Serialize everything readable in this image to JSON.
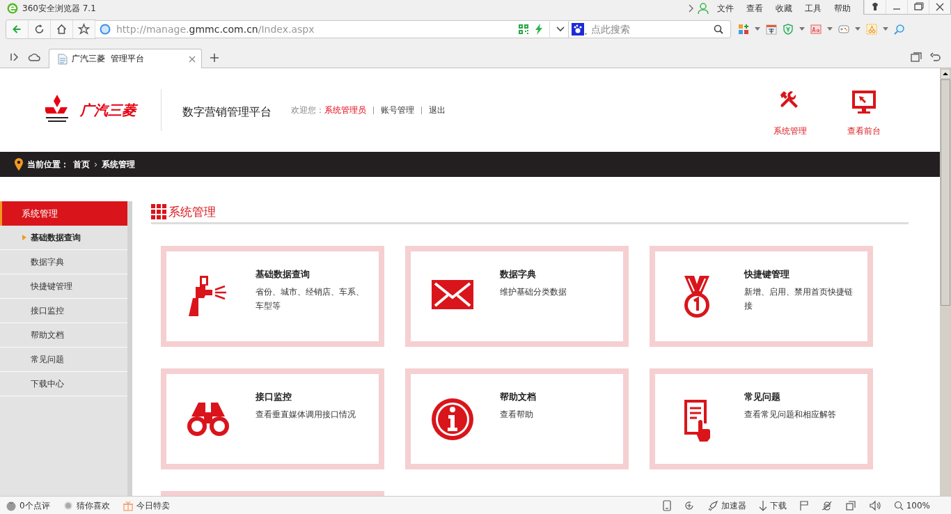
{
  "browser": {
    "title": "360安全浏览器 7.1",
    "menu": [
      "文件",
      "查看",
      "收藏",
      "工具",
      "帮助"
    ],
    "url": {
      "scheme": "http://manage.",
      "domain": "gmmc.com.cn",
      "path": "/Index.aspx"
    },
    "search_placeholder": "点此搜索",
    "tab": {
      "title": "广汽三菱  管理平台",
      "selected": true
    }
  },
  "header": {
    "brand": "广汽三菱",
    "platform_title": "数字营销管理平台",
    "welcome_label": "欢迎您：",
    "user": "系统管理员",
    "links": [
      "账号管理",
      "退出"
    ],
    "shortcuts": [
      {
        "label": "系统管理",
        "kind": "tools"
      },
      {
        "label": "查看前台",
        "kind": "monitor"
      }
    ]
  },
  "breadcrumb": {
    "label": "当前位置：",
    "items": [
      "首页",
      "系统管理"
    ]
  },
  "sidebar": {
    "title": "系统管理",
    "items": [
      {
        "label": "基础数据查询",
        "selected": true
      },
      {
        "label": "数据字典",
        "selected": false
      },
      {
        "label": "快捷键管理",
        "selected": false
      },
      {
        "label": "接口监控",
        "selected": false
      },
      {
        "label": "帮助文档",
        "selected": false
      },
      {
        "label": "常见问题",
        "selected": false
      },
      {
        "label": "下载中心",
        "selected": false
      }
    ]
  },
  "section_title": "系统管理",
  "cards": [
    {
      "kind": "spray-gun",
      "title": "基础数据查询",
      "desc": "省份、城市、经销店、车系、车型等"
    },
    {
      "kind": "envelope",
      "title": "数据字典",
      "desc": "维护基础分类数据"
    },
    {
      "kind": "medal",
      "title": "快捷键管理",
      "desc": "新增、启用、禁用首页快捷链接"
    },
    {
      "kind": "binoculars",
      "title": "接口监控",
      "desc": "查看垂直媒体调用接口情况"
    },
    {
      "kind": "info",
      "title": "帮助文档",
      "desc": "查看帮助"
    },
    {
      "kind": "document",
      "title": "常见问题",
      "desc": "查看常见问题和相应解答"
    },
    {
      "kind": "cut-off"
    }
  ],
  "status_bar": {
    "left": [
      {
        "kind": "tomato",
        "label": "0个点评"
      },
      {
        "kind": "dot",
        "label": "猜你喜欢"
      },
      {
        "kind": "gift",
        "label": "今日特卖"
      }
    ],
    "accelerator": "加速器",
    "download": "下载",
    "zoom": "100%"
  }
}
